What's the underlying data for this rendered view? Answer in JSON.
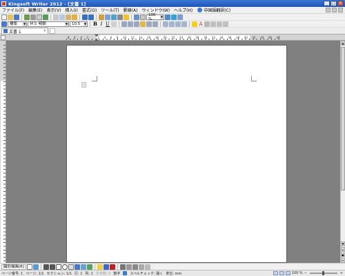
{
  "window": {
    "title": "Kingsoft Writer 2012 - [文書 1]",
    "controls": [
      "_",
      "□",
      "×"
    ]
  },
  "menu": {
    "items": [
      "ファイル(F)",
      "編集(E)",
      "表示(V)",
      "挿入(I)",
      "書式(O)",
      "ツール(T)",
      "罫線(A)",
      "ウィンドウ(W)",
      "ヘルプ(H)"
    ],
    "help_label": "中国語翻訳(C)",
    "help_search_placeholder": ""
  },
  "toolbar_standard": {
    "zoom_value": "100 %"
  },
  "toolbar_format": {
    "style_value": "標準",
    "font_value": "ＭＳ 明朝",
    "size_value": "10.5",
    "bold": "B",
    "italic": "I",
    "underline": "U",
    "font_color_label": "A"
  },
  "tabs": {
    "active_doc": "文書 1"
  },
  "ruler": {
    "numbers": [
      "8",
      "6",
      "4",
      "2",
      "",
      "2",
      "4",
      "6",
      "8",
      "10",
      "12",
      "14",
      "16",
      "18",
      "20",
      "22",
      "24",
      "26",
      "28",
      "30",
      "32",
      "34",
      "36",
      "38",
      "40",
      "42",
      "44",
      "46",
      "48"
    ]
  },
  "drawing_toolbar": {
    "draw_label": "図形描画(R)"
  },
  "status": {
    "page_num": "ページ番号: 1",
    "pages": "ページ: 1/1",
    "section": "セクション: 1/1",
    "line": "行: 1",
    "column": "列: 1",
    "chars": "文字数: 0",
    "mode": "数字",
    "spell": "スペルチェック: 開く",
    "unit": "単位: mm",
    "zoom": "100 %"
  },
  "colors": {
    "title_bar": "#2a63c4",
    "chrome": "#f0f0f0",
    "workspace": "#808080",
    "page": "#ffffff"
  }
}
